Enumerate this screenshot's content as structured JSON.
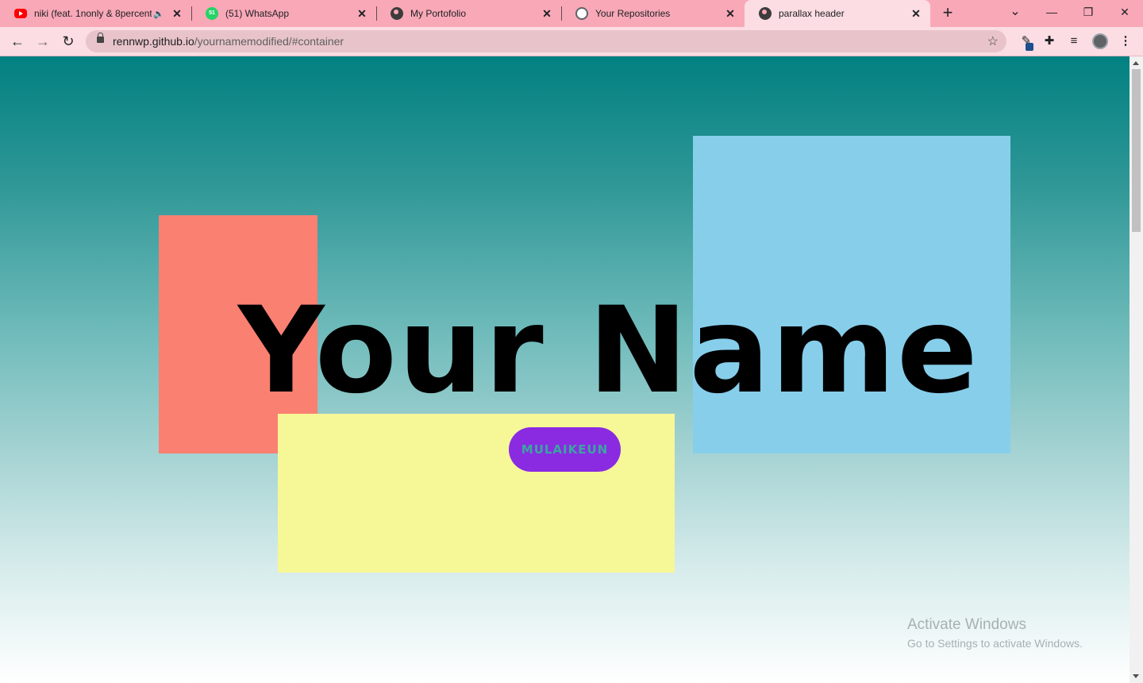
{
  "browser": {
    "tabs": [
      {
        "title": "niki (feat. 1nonly & 8percent",
        "favicon": "youtube-icon",
        "muted": true
      },
      {
        "title": "(51) WhatsApp",
        "favicon": "whatsapp-icon",
        "badge": "51"
      },
      {
        "title": "My Portofolio",
        "favicon": "globe-icon"
      },
      {
        "title": "Your Repositories",
        "favicon": "github-icon"
      },
      {
        "title": "parallax header",
        "favicon": "globe-icon",
        "active": true
      }
    ],
    "new_tab_icon": "+",
    "window_controls": {
      "minimize": "—",
      "restore": "❐",
      "close": "✕"
    },
    "tab_search_icon": "⌄",
    "url": {
      "host": "rennwp.github.io",
      "path": "/yournamemodified/#container"
    }
  },
  "page": {
    "hero_title": "Your Name",
    "cta_label": "MULAIKEUN",
    "colors": {
      "coral": "#fa8072",
      "sky": "#87ceeb",
      "yellow": "#f6f797",
      "button": "#8a2be2",
      "gradient_top": "#028081",
      "gradient_bottom": "#ffffff"
    }
  },
  "os_watermark": {
    "line1": "Activate Windows",
    "line2": "Go to Settings to activate Windows."
  }
}
